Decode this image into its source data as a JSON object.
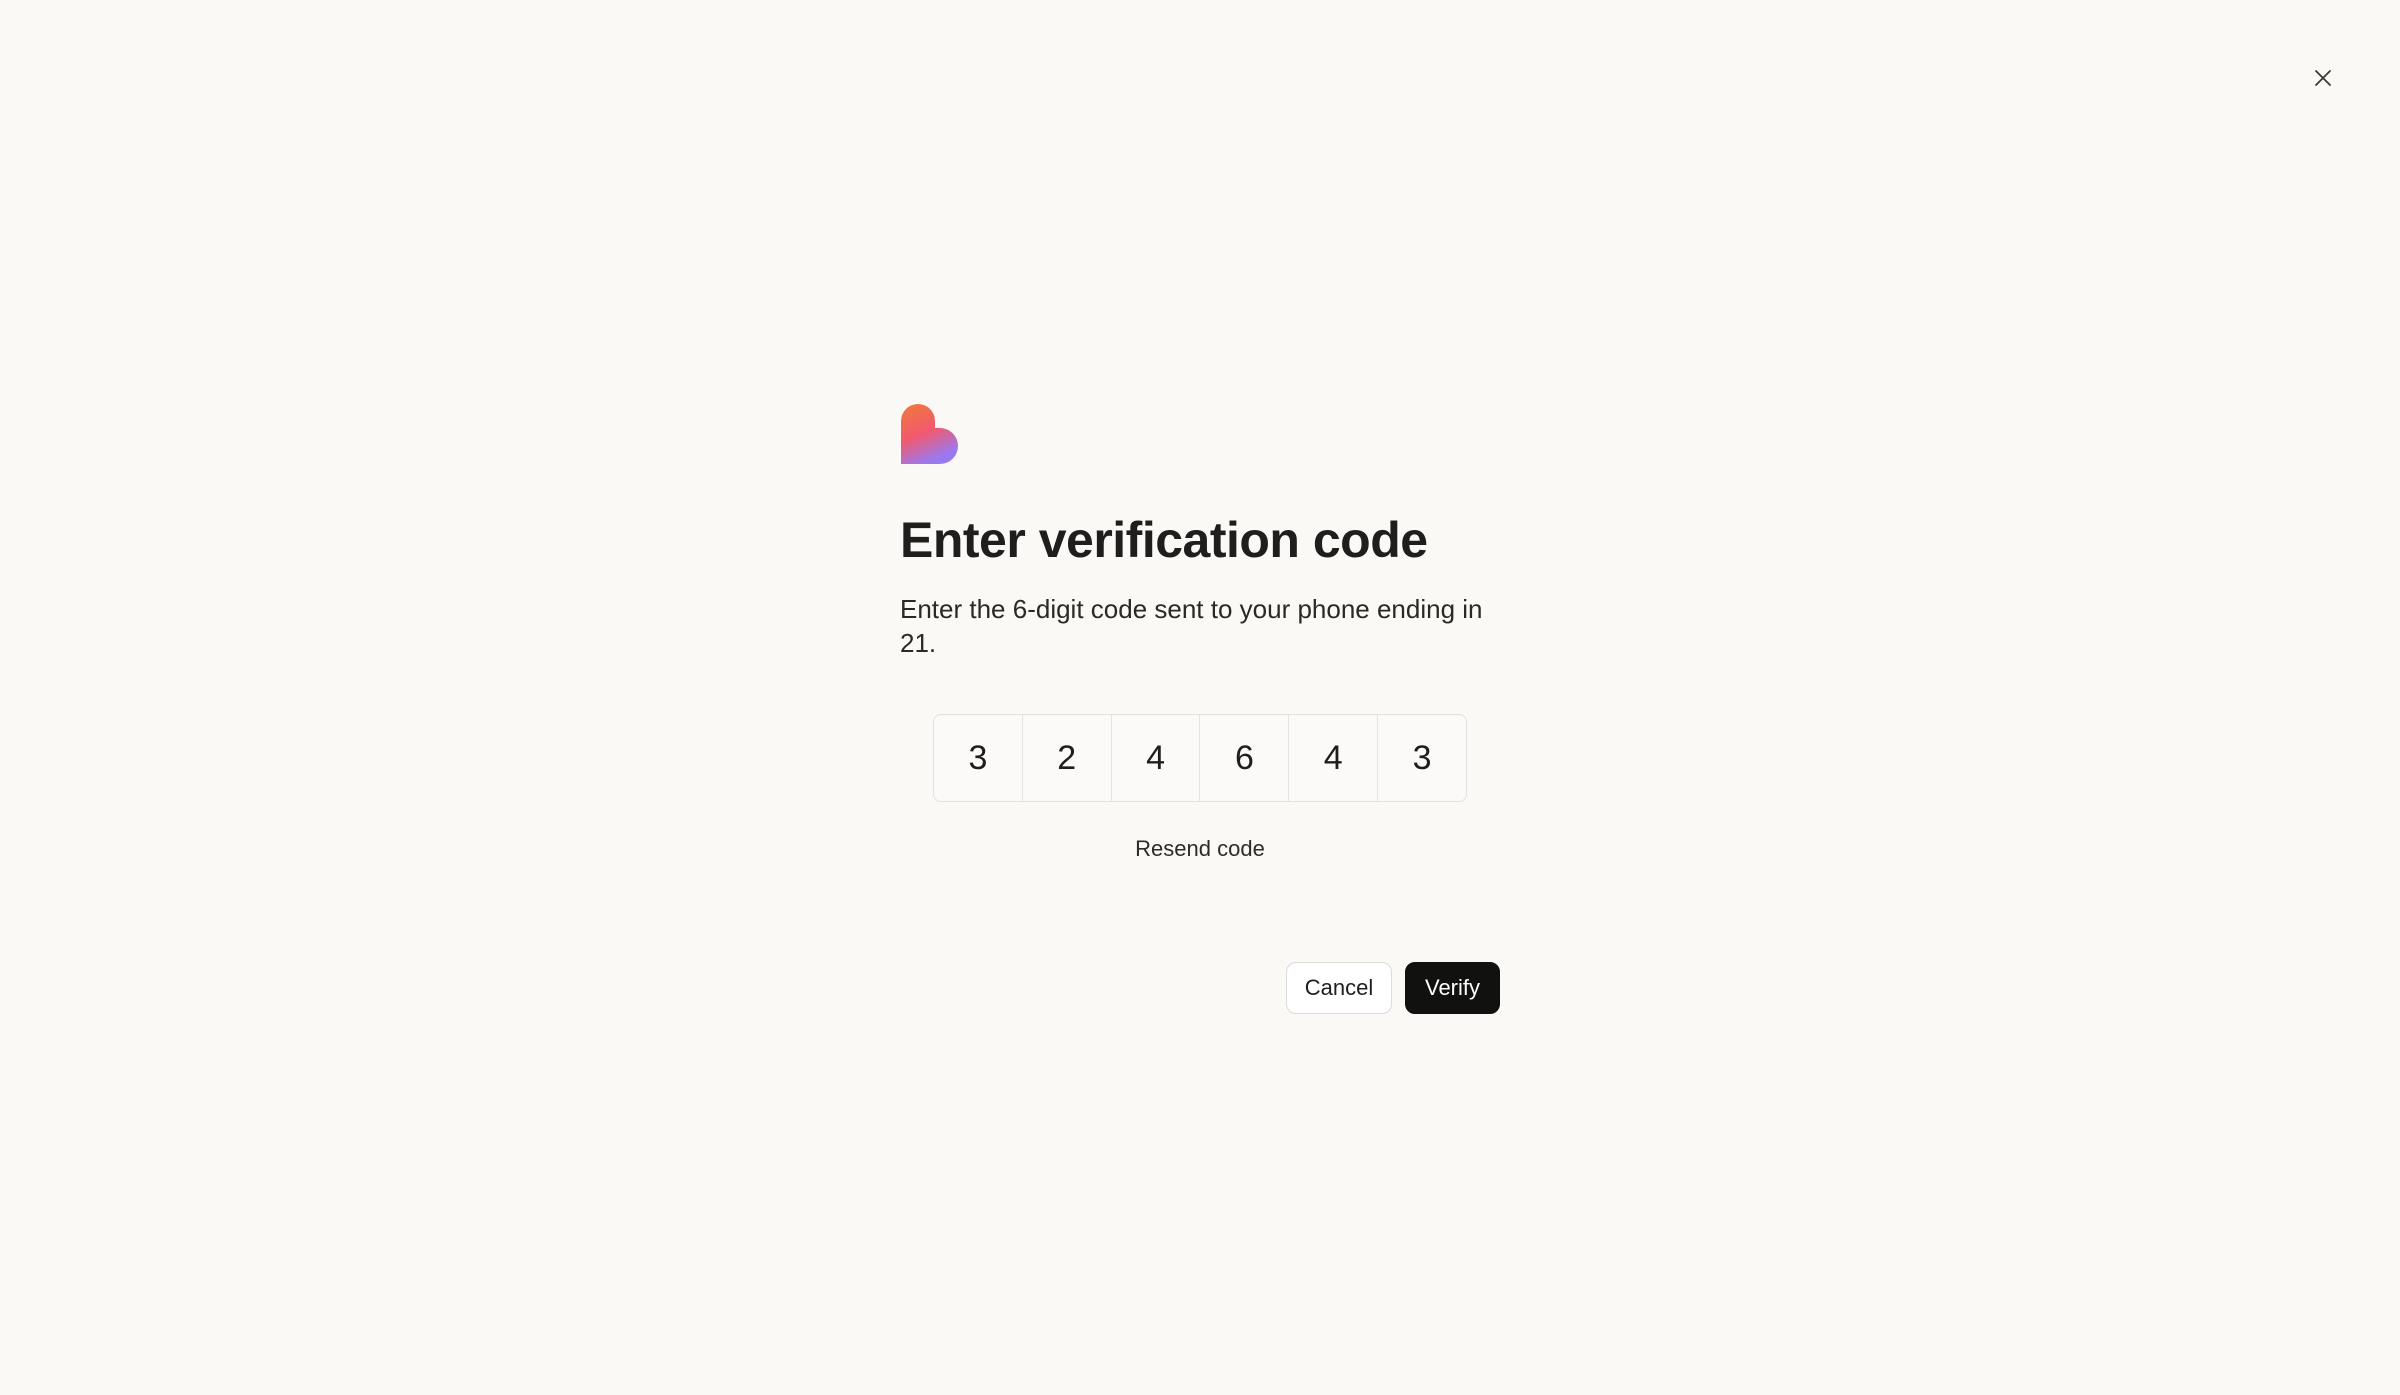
{
  "dialog": {
    "title": "Enter verification code",
    "subtitle": "Enter the 6-digit code sent to your phone ending in 21.",
    "code_digits": [
      "3",
      "2",
      "4",
      "6",
      "4",
      "3"
    ],
    "resend_label": "Resend code",
    "cancel_label": "Cancel",
    "verify_label": "Verify"
  },
  "icons": {
    "close": "close-icon",
    "logo": "heart-logo"
  },
  "colors": {
    "background": "#faf9f6",
    "primary_button": "#111110",
    "logo_gradient_top": "#f07a3a",
    "logo_gradient_mid": "#f2596e",
    "logo_gradient_bottom": "#9a79f0"
  }
}
